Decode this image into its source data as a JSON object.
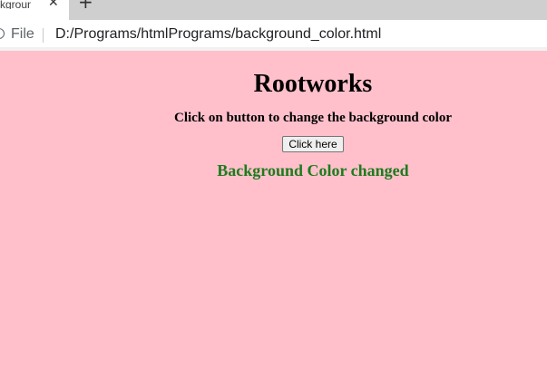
{
  "browser": {
    "tab_title": "kground C",
    "tab_close": "✕",
    "new_tab": "+",
    "file_label": "File",
    "url": "D:/Programs/htmlPrograms/background_color.html"
  },
  "page": {
    "background": "#ffc0cb",
    "heading": "Rootworks",
    "subtitle": "Click on button to change the background color",
    "button_label": "Click here",
    "status_text": "Background Color changed",
    "status_color": "#1e7b1e"
  }
}
